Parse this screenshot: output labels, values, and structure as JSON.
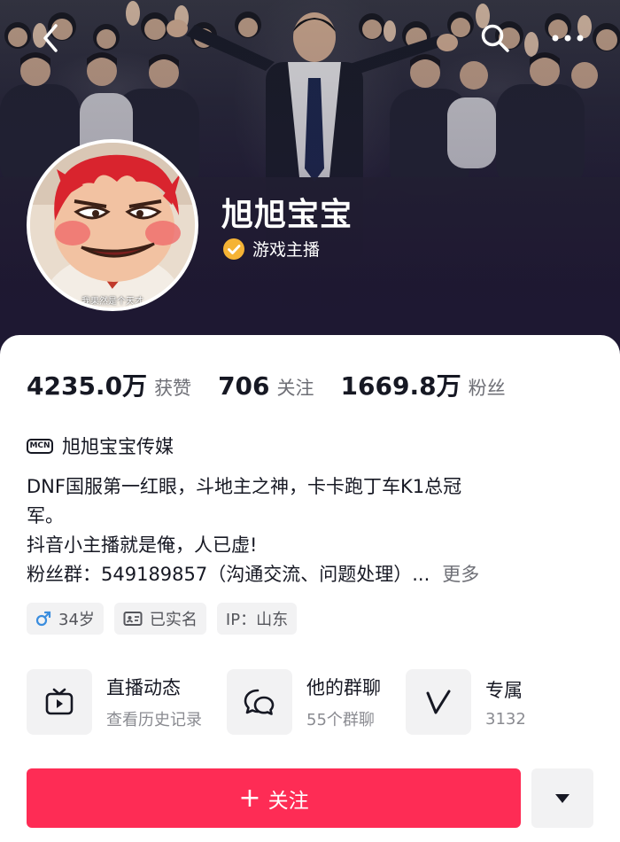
{
  "header": {
    "back_icon": "back-arrow-icon",
    "search_icon": "search-icon",
    "more_icon": "more-dots-icon"
  },
  "profile": {
    "avatar_caption": "我果然是个天才",
    "nickname": "旭旭宝宝",
    "verify_label": "游戏主播",
    "verify_color": "#f5b335"
  },
  "stats": [
    {
      "value": "4235.0万",
      "label": "获赞"
    },
    {
      "value": "706",
      "label": "关注"
    },
    {
      "value": "1669.8万",
      "label": "粉丝"
    }
  ],
  "mcn": {
    "badge": "MCN",
    "name": "旭旭宝宝传媒"
  },
  "bio": {
    "lines": [
      "DNF国服第一红眼，斗地主之神，卡卡跑丁车K1总冠",
      "军。",
      "抖音小主播就是俺，人已虚!"
    ],
    "last_line": "粉丝群：549189857（沟通交流、问题处理）...",
    "more": "更多"
  },
  "tags": [
    {
      "icon": "male-icon",
      "label": "34岁"
    },
    {
      "icon": "id-card-icon",
      "label": "已实名"
    },
    {
      "icon": "",
      "label": "IP：山东"
    }
  ],
  "entries": [
    {
      "icon": "tv-play-icon",
      "title": "直播动态",
      "subtitle": "查看历史记录"
    },
    {
      "icon": "group-chat-icon",
      "title": "他的群聊",
      "subtitle": "55个群聊"
    },
    {
      "icon": "v-icon",
      "title": "专属",
      "subtitle": "3132"
    }
  ],
  "actions": {
    "follow_label": "关注",
    "follow_color": "#fe2c55",
    "dropdown_icon": "caret-down-icon"
  }
}
